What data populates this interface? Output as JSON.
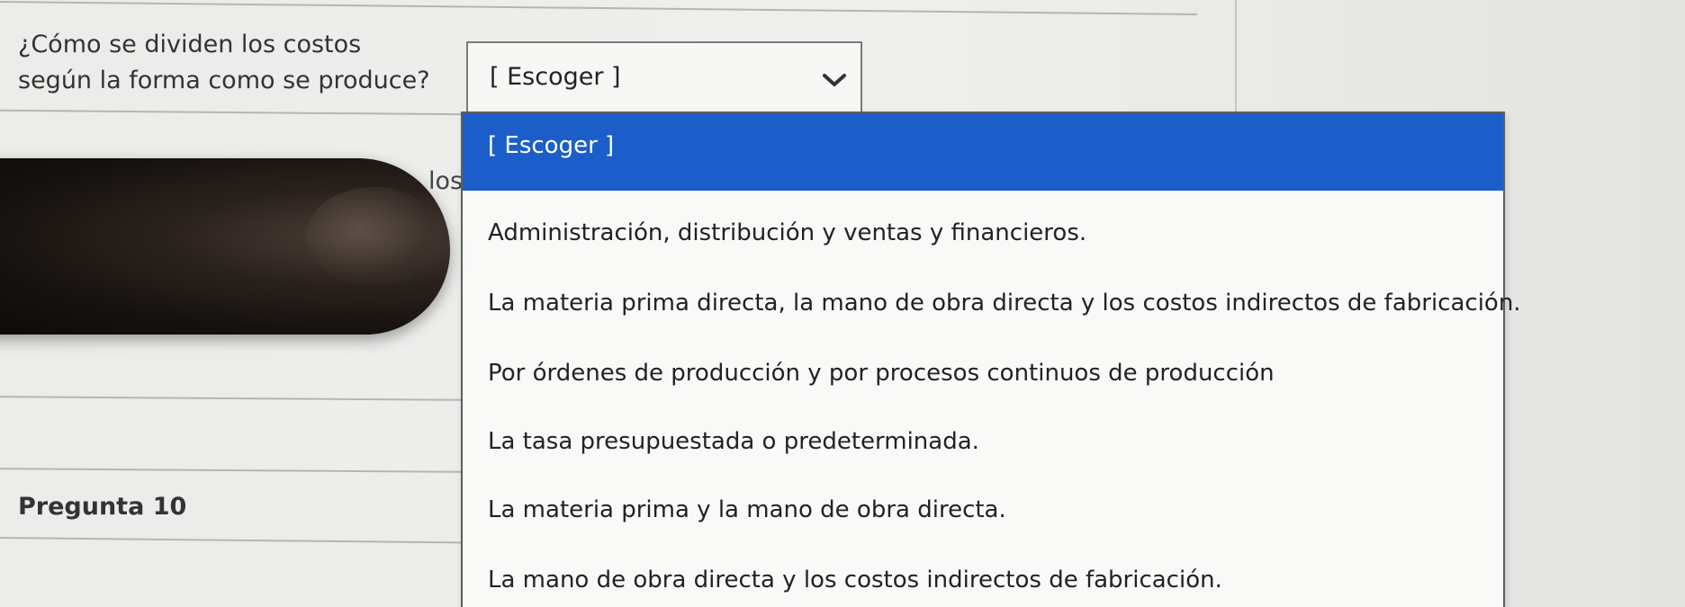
{
  "question": {
    "text": "¿Cómo se dividen los costos según la forma como se produce?"
  },
  "select": {
    "value": "[ Escoger ]"
  },
  "dropdown": {
    "options": [
      "[ Escoger ]",
      "Administración, distribución y ventas y financieros.",
      "La materia prima directa, la mano de obra directa y los costos indirectos de fabricación.",
      "Por órdenes de producción y por procesos continuos de producción",
      "La tasa presupuestada o predeterminada.",
      "La materia prima y la mano de obra directa.",
      "La mano de obra directa y los costos indirectos de fabricación."
    ],
    "selected_index": 0,
    "highlight_color": "#1c5ec9"
  },
  "partial_text": "los",
  "next_question": {
    "label": "Pregunta 10"
  },
  "icons": [
    "chevron-down-icon"
  ]
}
